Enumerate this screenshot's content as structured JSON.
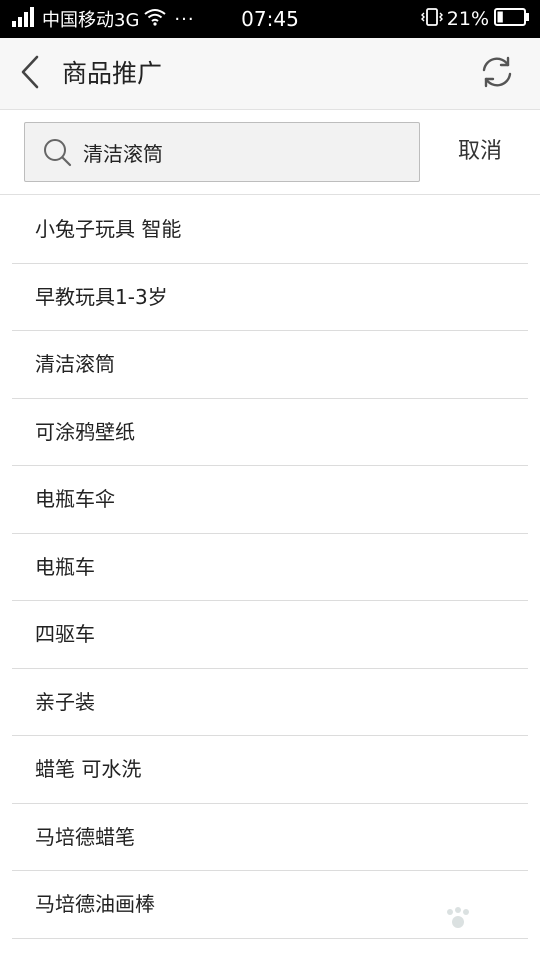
{
  "status_bar": {
    "carrier": "中国移动3G",
    "dots": "···",
    "time": "07:45",
    "battery_percent": "21%",
    "battery_level": 0.21
  },
  "header": {
    "title": "商品推广"
  },
  "search": {
    "query": "清洁滚筒",
    "cancel_label": "取消"
  },
  "suggestions": [
    "小兔子玩具 智能",
    "早教玩具1-3岁",
    "清洁滚筒",
    "可涂鸦壁纸",
    "电瓶车伞",
    "电瓶车",
    "四驱车",
    "亲子装",
    "蜡笔 可水洗",
    "马培德蜡笔",
    "马培德油画棒"
  ],
  "colors": {
    "status_bg": "#000000",
    "header_bg": "#f7f7f7",
    "search_bg": "#f2f2f2",
    "divider": "#dcdcdc"
  },
  "icons": [
    "signal-icon",
    "wifi-icon",
    "vibrate-icon",
    "battery-icon",
    "back-icon",
    "refresh-icon",
    "search-icon"
  ]
}
